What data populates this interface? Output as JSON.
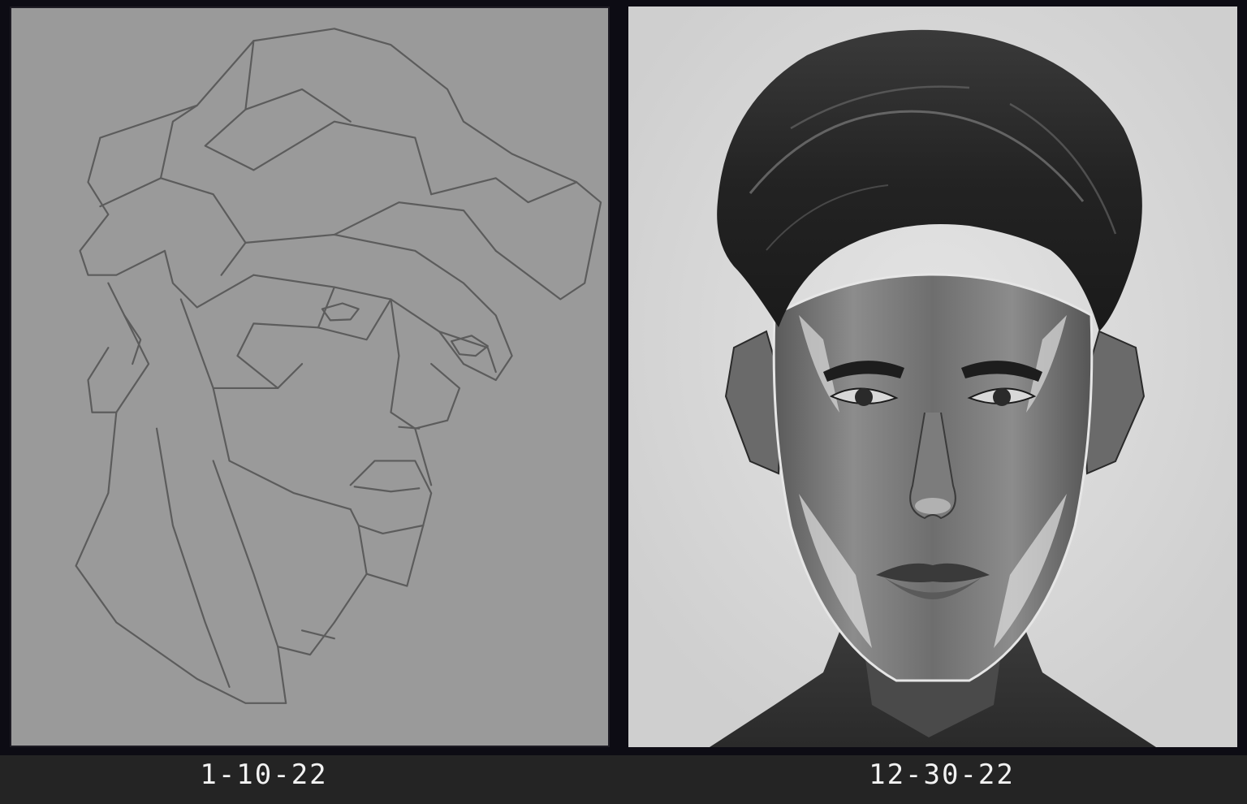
{
  "captions": {
    "left": "1-10-22",
    "right": "12-30-22"
  },
  "colors": {
    "background": "#0d0c14",
    "caption_bar": "#242424",
    "sketch_panel": "#9a9a9a",
    "sketch_line": "#5a5a5a",
    "painting_panel": "#dcdcdc",
    "hair": "#2a2a2a",
    "skin": "#7a7a7a",
    "highlight": "#e8e8e8"
  },
  "images": {
    "left": "geometric-sketch-head",
    "right": "rendered-portrait-head"
  }
}
